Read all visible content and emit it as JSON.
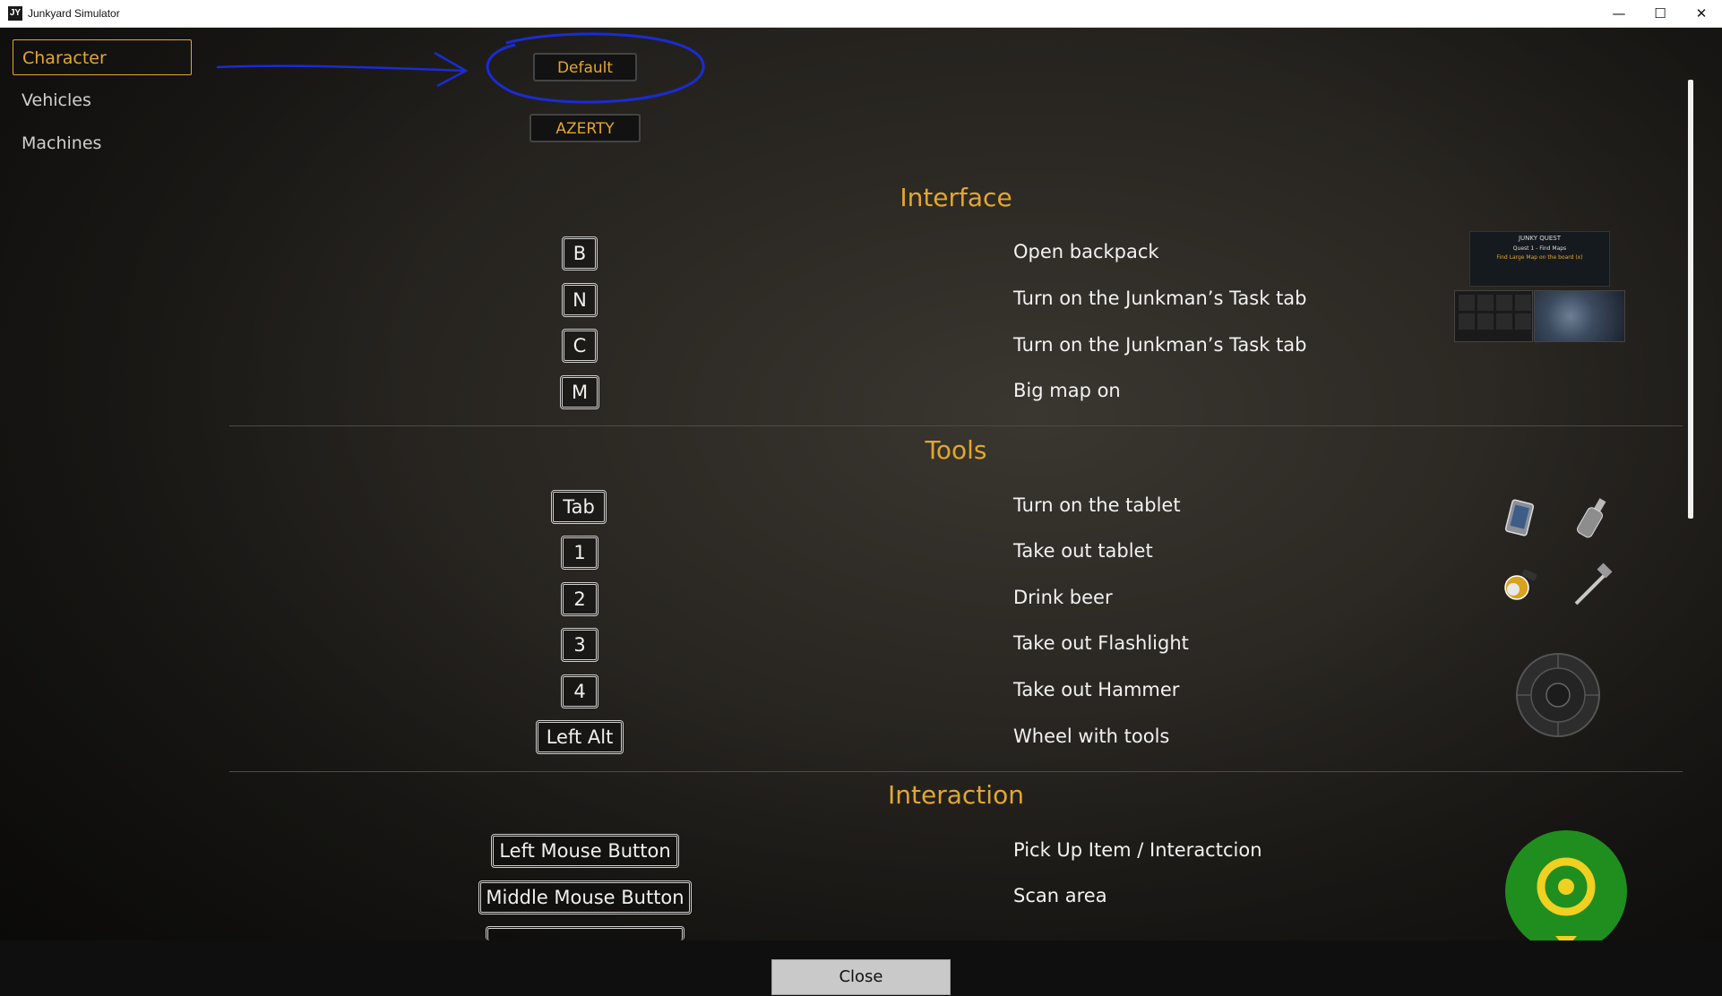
{
  "window": {
    "title": "Junkyard Simulator",
    "icon_text": "JY",
    "controls": [
      "minimize-icon",
      "maximize-icon",
      "close-icon"
    ]
  },
  "colors": {
    "accent": "#e3a72f",
    "annotation": "#1a2bd6",
    "beacon_green": "#1f8e1f"
  },
  "sidebar": {
    "items": [
      {
        "label": "Character",
        "active": true
      },
      {
        "label": "Vehicles",
        "active": false
      },
      {
        "label": "Machines",
        "active": false
      }
    ]
  },
  "presets": {
    "default_label": "Default",
    "azerty_label": "AZERTY"
  },
  "sections": {
    "interface": {
      "title": "Interface",
      "rows": [
        {
          "key": "B",
          "action": "Open backpack"
        },
        {
          "key": "N",
          "action": "Turn on the Junkman’s Task tab"
        },
        {
          "key": "C",
          "action": "Turn on the Junkman’s Task tab"
        },
        {
          "key": "M",
          "action": "Big map on"
        }
      ]
    },
    "tools": {
      "title": "Tools",
      "rows": [
        {
          "key": "Tab",
          "action": "Turn on the tablet"
        },
        {
          "key": "1",
          "action": "Take out tablet"
        },
        {
          "key": "2",
          "action": "Drink beer"
        },
        {
          "key": "3",
          "action": "Take out Flashlight"
        },
        {
          "key": "4",
          "action": "Take out Hammer"
        },
        {
          "key": "Left Alt",
          "action": "Wheel with tools"
        }
      ]
    },
    "interaction": {
      "title": "Interaction",
      "rows": [
        {
          "key": "Left Mouse Button",
          "action": "Pick Up Item / Interactcion"
        },
        {
          "key": "Middle Mouse Button",
          "action": "Scan area"
        }
      ]
    }
  },
  "quest_preview": {
    "header": "JUNKY QUEST",
    "line1": "Quest 1 - Find Maps",
    "line2": "Find Large Map on the board (x)"
  },
  "footer": {
    "close_label": "Close"
  }
}
